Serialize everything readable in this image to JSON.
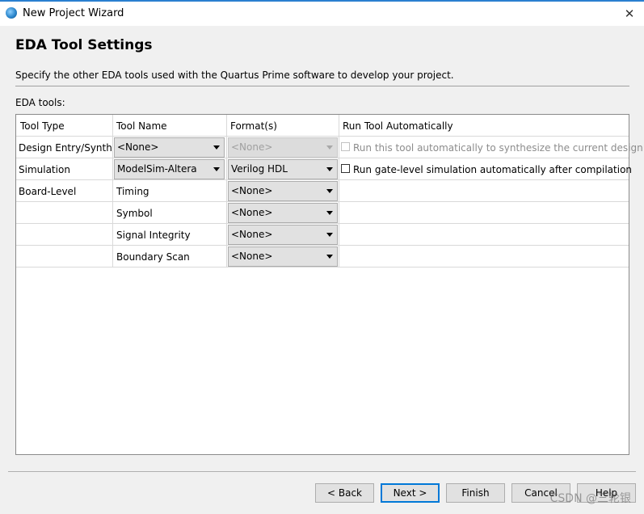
{
  "window": {
    "title": "New Project Wizard"
  },
  "header": {
    "title": "EDA Tool Settings",
    "description": "Specify the other EDA tools used with the Quartus Prime software to develop your project."
  },
  "eda_tools_label": "EDA tools:",
  "table": {
    "columns": [
      "Tool Type",
      "Tool Name",
      "Format(s)",
      "Run Tool Automatically"
    ],
    "rows": [
      {
        "type": "Design Entry/Synth...",
        "name": "<None>",
        "format": "<None>",
        "run_auto": "Run this tool automatically to synthesize the current design",
        "run_auto_checked": false,
        "format_enabled": false,
        "run_auto_enabled": false
      },
      {
        "type": "Simulation",
        "name": "ModelSim-Altera",
        "format": "Verilog HDL",
        "run_auto": "Run gate-level simulation automatically after compilation",
        "run_auto_checked": false,
        "format_enabled": true,
        "run_auto_enabled": true
      },
      {
        "type": "Board-Level",
        "name": "Timing",
        "format": "<None>"
      },
      {
        "type": "",
        "name": "Symbol",
        "format": "<None>"
      },
      {
        "type": "",
        "name": "Signal Integrity",
        "format": "<None>"
      },
      {
        "type": "",
        "name": "Boundary Scan",
        "format": "<None>"
      }
    ]
  },
  "buttons": {
    "back": "< Back",
    "next": "Next >",
    "finish": "Finish",
    "cancel": "Cancel",
    "help": "Help"
  },
  "watermark": "CSDN @三轮银",
  "colors": {
    "accent": "#0078d7",
    "titlebar_border": "#2a7fd0",
    "button_face": "#e1e1e1"
  }
}
